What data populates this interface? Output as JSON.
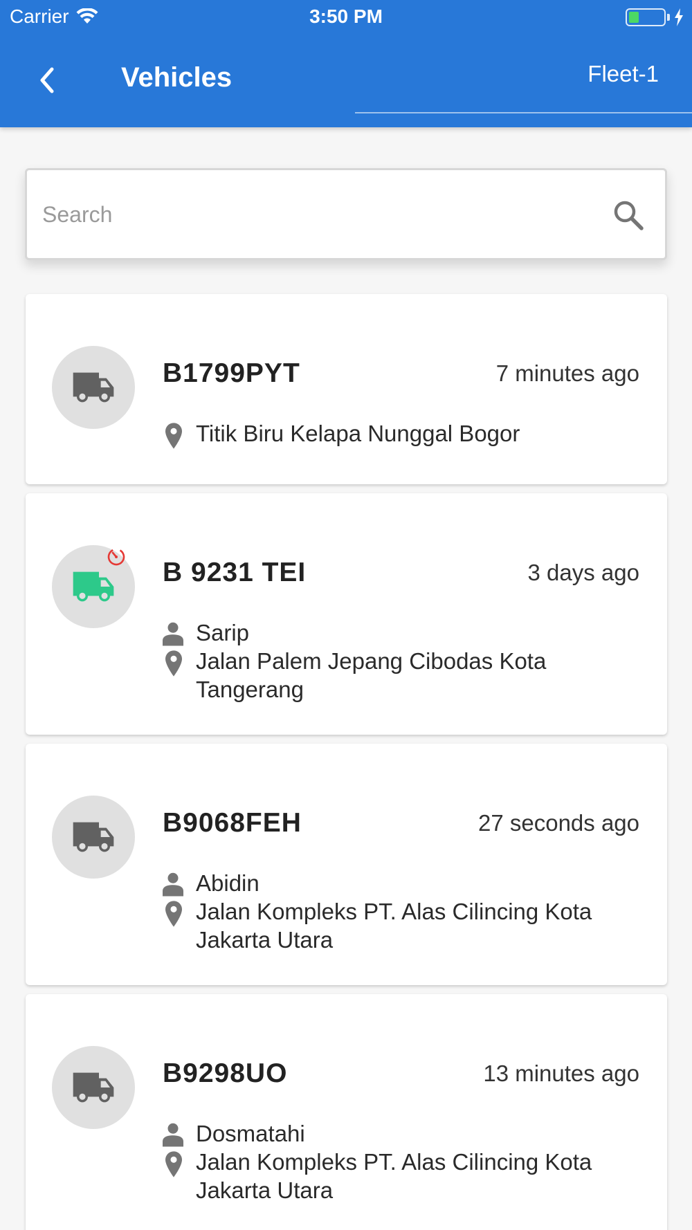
{
  "status_bar": {
    "carrier": "Carrier",
    "time": "3:50 PM",
    "battery_color": "#4cd964",
    "battery_level": 0.3
  },
  "header": {
    "title": "Vehicles",
    "back_icon": "chevron-left-icon",
    "fleet": "Fleet-1",
    "color": "#2878d8"
  },
  "search": {
    "placeholder": "Search",
    "value": "",
    "icon": "search-icon"
  },
  "vehicles": [
    {
      "plate": "B1799PYT",
      "time_ago": "7 minutes ago",
      "driver": "",
      "location": "Titik Biru Kelapa Nunggal Bogor",
      "icon": "truck-icon",
      "icon_color": "#616161",
      "timer_badge": false
    },
    {
      "plate": "B 9231 TEI",
      "time_ago": "3 days ago",
      "driver": "Sarip",
      "location": "Jalan Palem Jepang Cibodas Kota Tangerang",
      "icon": "truck-icon",
      "icon_color": "#2dc98a",
      "timer_badge": true,
      "timer_badge_color": "#e53935"
    },
    {
      "plate": "B9068FEH",
      "time_ago": "27 seconds ago",
      "driver": "Abidin",
      "location": "Jalan Kompleks PT. Alas Cilincing Kota Jakarta Utara",
      "icon": "truck-icon",
      "icon_color": "#616161",
      "timer_badge": false
    },
    {
      "plate": "B9298UO",
      "time_ago": "13 minutes ago",
      "driver": "Dosmatahi",
      "location": "Jalan Kompleks PT. Alas Cilincing Kota Jakarta Utara",
      "icon": "truck-icon",
      "icon_color": "#616161",
      "timer_badge": false
    }
  ]
}
